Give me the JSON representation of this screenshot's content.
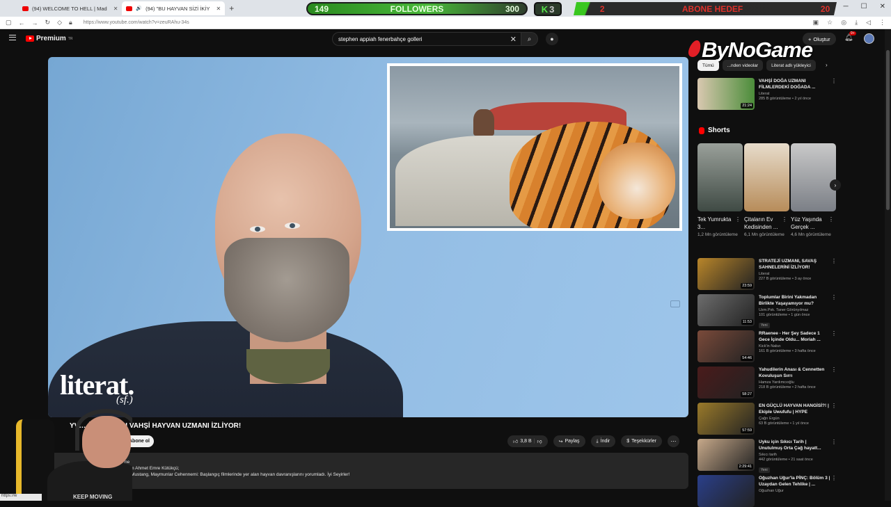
{
  "browser": {
    "tabs": [
      {
        "label": "(94) WELCOME TO HELL | Mad"
      },
      {
        "label": "(94) \"BU HAYVAN SİZİ İKİY"
      }
    ],
    "new_tab": "+",
    "url": "https://www.youtube.com/watch?v=zeuRAhu-34s",
    "status_url": "https://w"
  },
  "overlay": {
    "followers_current": "149",
    "followers_label": "FOLLOWERS",
    "followers_goal": "300",
    "k_letter": "K",
    "k_number": "3",
    "sub_current": "2",
    "sub_label": "ABONE HEDEF",
    "sub_goal": "20",
    "brand": "ByNoGame"
  },
  "youtube": {
    "logo": "Premium",
    "logo_region": "TR",
    "search_value": "stephen appiah fenerbahçe golleri",
    "create_label": "Oluştur",
    "notif_count": "9+"
  },
  "player": {
    "watermark": "literat.",
    "watermark_sub": "(sf.)"
  },
  "video": {
    "title": "YV… ÖLEBİLİR\" I VAHŞİ HAYVAN UZMANI İZLİYOR!",
    "subscribe": "Abone ol",
    "likes": "3,8 B",
    "share": "Paylaş",
    "download": "İndir",
    "thanks": "Teşekkürler",
    "desc_line1": "ne",
    "desc_line2": "ekim Ahmet Emre Kütükçü;",
    "desc_line3": "he Mustang, Maymunlar Cehennemi: Başlangıç filmlerinde yer alan hayvan davranışlarını yorumladı. İyi Seyirler!",
    "webcam_text": "KEEP MOVING"
  },
  "sidebar": {
    "chips": [
      "Tümü",
      "...nden videolar",
      "Literat adlı yükleyici"
    ],
    "top_video": {
      "title": "VAHŞİ DOĞA UZMANI FİLMLERDEKİ DOĞADA ...",
      "channel": "Literat",
      "stats": "285 B görüntüleme • 2 yıl önce",
      "duration": "21:24"
    },
    "shorts_title": "Shorts",
    "shorts": [
      {
        "title": "Tek Yumrukta 3...",
        "views": "1,2 Mn görüntüleme"
      },
      {
        "title": "Çitaların Ev Kedisinden ...",
        "views": "6,1 Mn görüntüleme"
      },
      {
        "title": "Yüz Yaşında Gerçek ...",
        "views": "4,6 Mn görüntüleme"
      }
    ],
    "videos": [
      {
        "title": "STRATEJİ UZMANI, SAVAŞ SAHNELERİNİ İZLİYOR!",
        "channel": "Literat",
        "stats": "227 B görüntüleme • 3 ay önce",
        "duration": "23:59",
        "tag": "",
        "color": "#b9862a"
      },
      {
        "title": "Toplumlar Birini Yakmadan Birlikte Yaşayamıyor mu?",
        "channel": "Uzm.Psk. Taner Görünyılmaz",
        "stats": "101 görüntüleme • 1 gün önce",
        "duration": "11:53",
        "tag": "Yeni",
        "color": "#6d6d6d"
      },
      {
        "title": "RRaenee - Her Şey Sadece 1 Gece İçinde Oldu... Moriah ...",
        "channel": "Kick'in Nabzı",
        "stats": "161 B görüntüleme • 3 hafta önce",
        "duration": "54:46",
        "tag": "",
        "color": "#7a4a3a"
      },
      {
        "title": "Yahudilerin Anası & Cennetten Kovuluşun Sırrı",
        "channel": "Hamza Yardımcıoğlu",
        "stats": "218 B görüntüleme • 2 hafta önce",
        "duration": "58:27",
        "tag": "",
        "color": "#4a1b1b"
      },
      {
        "title": "EN GÜÇLÜ HAYVAN HANGİSİ?! | Ekiple Uwufufu | HYPE",
        "channel": "Çağrı Ergün",
        "stats": "63 B görüntüleme • 1 yıl önce",
        "duration": "57:59",
        "tag": "",
        "color": "#9a7a2a"
      },
      {
        "title": "Uyku için Sıkıcı Tarih | Unutulmuş Orta Çağ hayatt...",
        "channel": "Sıkıcı tarih",
        "stats": "442 görüntüleme • 21 saat önce",
        "duration": "2:29:41",
        "tag": "Yeni",
        "color": "#c7a98a"
      },
      {
        "title": "Oğuzhan Uğur'la PİNÇ: Bölüm 3 | Uzaydan Gelen Tehlike | ...",
        "channel": "Oğuzhan Uğur",
        "stats": "",
        "duration": "",
        "tag": "",
        "color": "#2a3f8a"
      }
    ]
  }
}
